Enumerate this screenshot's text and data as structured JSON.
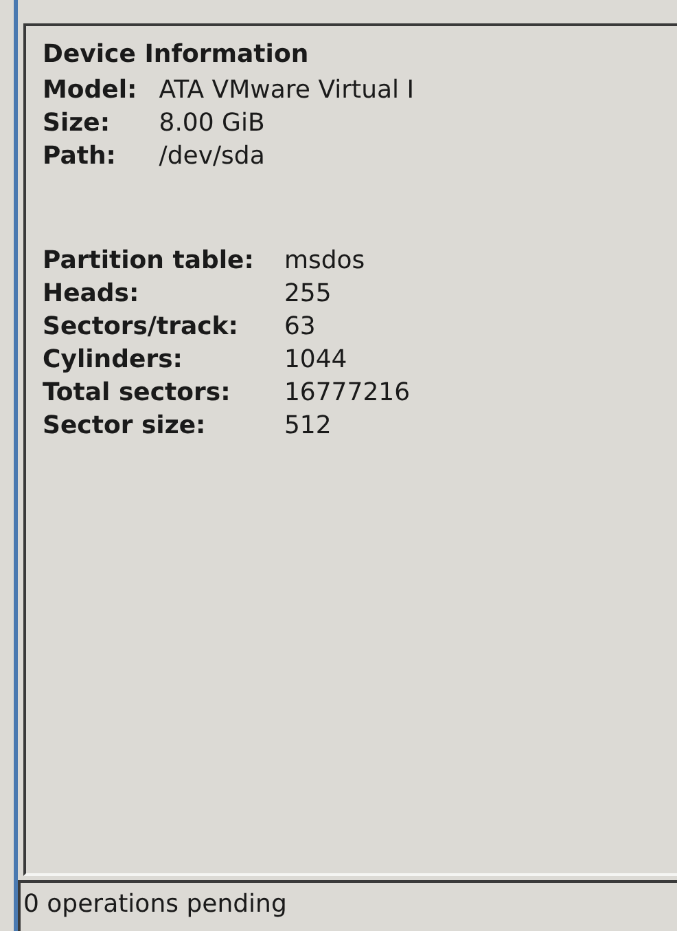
{
  "panel": {
    "title": "Device Information",
    "general": [
      {
        "label": "Model:",
        "value": "ATA VMware Virtual I"
      },
      {
        "label": "Size:",
        "value": "8.00 GiB"
      },
      {
        "label": "Path:",
        "value": "/dev/sda"
      }
    ],
    "geometry": [
      {
        "label": "Partition table:",
        "value": "msdos"
      },
      {
        "label": "Heads:",
        "value": "255"
      },
      {
        "label": "Sectors/track:",
        "value": "63"
      },
      {
        "label": "Cylinders:",
        "value": "1044"
      },
      {
        "label": "Total sectors:",
        "value": "16777216"
      },
      {
        "label": "Sector size:",
        "value": "512"
      }
    ]
  },
  "status_bar": {
    "text": "0 operations pending"
  }
}
